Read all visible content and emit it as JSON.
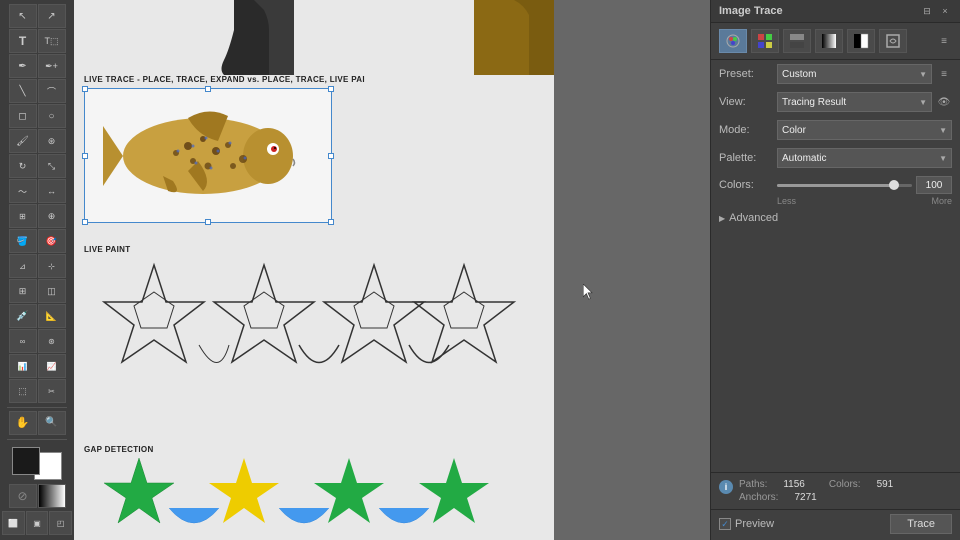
{
  "panel": {
    "title": "Image Trace",
    "close_btn": "×",
    "expand_btn": "≡",
    "float_btn": "⊟"
  },
  "preset_icons": [
    {
      "id": "auto-color",
      "symbol": "⊙",
      "active": true
    },
    {
      "id": "high-color",
      "symbol": "🎨",
      "active": false
    },
    {
      "id": "low-color",
      "symbol": "▦",
      "active": false
    },
    {
      "id": "grayscale",
      "symbol": "▧",
      "active": false
    },
    {
      "id": "black-white",
      "symbol": "◨",
      "active": false
    },
    {
      "id": "outline",
      "symbol": "↺",
      "active": false
    }
  ],
  "preset": {
    "label": "Preset:",
    "value": "Custom"
  },
  "view": {
    "label": "View:",
    "value": "Tracing Result"
  },
  "mode": {
    "label": "Mode:",
    "value": "Color"
  },
  "palette": {
    "label": "Palette:",
    "value": "Automatic"
  },
  "colors": {
    "label": "Colors:",
    "value": "100",
    "hint_less": "Less",
    "hint_more": "More",
    "slider_pct": 85
  },
  "advanced": {
    "label": "Advanced"
  },
  "info": {
    "paths_label": "Paths:",
    "paths_value": "1156",
    "colors_label": "Colors:",
    "colors_value": "591",
    "anchors_label": "Anchors:",
    "anchors_value": "7271"
  },
  "preview": {
    "label": "Preview",
    "checked": true
  },
  "trace_btn": "Trace",
  "canvas": {
    "live_trace_label": "LIVE TRACE - PLACE, TRACE, EXPAND vs. PLACE, TRACE, LIVE PAI",
    "live_paint_label": "LIVE PAINT",
    "gap_detection_label": "GAP DETECTION"
  },
  "toolbar": {
    "tools": [
      "↖",
      "T",
      "⬡",
      "◻",
      "╲",
      "◉",
      "✏",
      "◈",
      "☁",
      "✂",
      "✋",
      "🔍",
      "◆",
      "▼"
    ]
  }
}
